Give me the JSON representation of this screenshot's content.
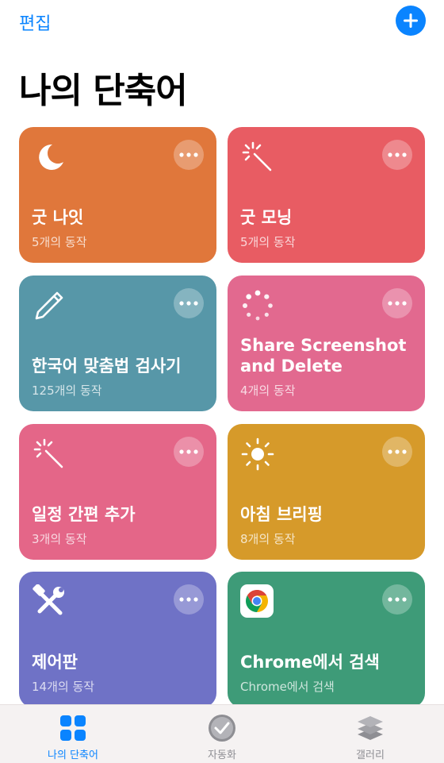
{
  "header": {
    "edit_label": "편집",
    "add_icon": "plus-icon",
    "title": "나의 단축어"
  },
  "shortcuts": [
    {
      "name": "굿 나잇",
      "subtitle": "5개의 동작",
      "icon": "moon-icon",
      "color": "#e0773b"
    },
    {
      "name": "굿 모닝",
      "subtitle": "5개의 동작",
      "icon": "magic-wand-icon",
      "color": "#e85c63"
    },
    {
      "name": "한국어 맞춤법 검사기",
      "subtitle": "125개의 동작",
      "icon": "pencil-icon",
      "color": "#5797a8"
    },
    {
      "name": "Share Screenshot and Delete",
      "subtitle": "4개의 동작",
      "icon": "spinner-icon",
      "color": "#e2698f"
    },
    {
      "name": "일정 간편 추가",
      "subtitle": "3개의 동작",
      "icon": "magic-wand-icon",
      "color": "#e46688"
    },
    {
      "name": "아침 브리핑",
      "subtitle": "8개의 동작",
      "icon": "sun-icon",
      "color": "#d69a2a"
    },
    {
      "name": "제어판",
      "subtitle": "14개의 동작",
      "icon": "tools-icon",
      "color": "#6f72c6"
    },
    {
      "name": "Chrome에서 검색",
      "subtitle": "Chrome에서 검색",
      "icon": "chrome-icon",
      "color": "#3e9b78"
    }
  ],
  "tabbar": {
    "tabs": [
      {
        "label": "나의 단축어",
        "icon": "grid-icon",
        "active": true
      },
      {
        "label": "자동화",
        "icon": "checkmark-clock-icon",
        "active": false
      },
      {
        "label": "갤러리",
        "icon": "layers-icon",
        "active": false
      }
    ]
  },
  "colors": {
    "accent": "#0a84ff",
    "tab_inactive": "#8e8e93"
  }
}
